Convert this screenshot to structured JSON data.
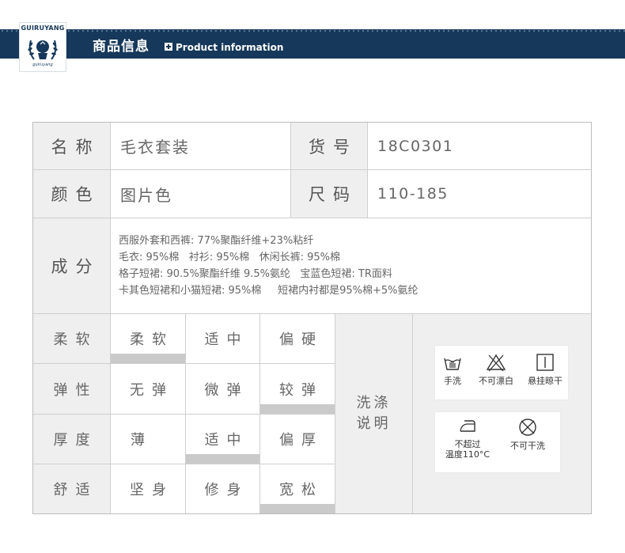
{
  "header": {
    "brand": "GUIRUYANG",
    "brand_sub": "guiruyang",
    "title_cn": "商品信息",
    "title_en": "Product information",
    "colors": {
      "banner": "#16385a",
      "gray_cell": "#efefef",
      "indicator": "#cacaca"
    }
  },
  "table": {
    "name_label": "名称",
    "name_value": "毛衣套装",
    "sku_label": "货号",
    "sku_value": "18C0301",
    "color_label": "颜色",
    "color_value": "图片色",
    "size_label": "尺码",
    "size_value": "110-185",
    "composition_label": "成分",
    "composition_lines": [
      "西服外套和西裤: 77%聚酯纤维+23%粘纤",
      "毛衣: 95%棉   衬衫: 95%棉   休闲长裤: 95%棉",
      "格子短裙: 90.5%聚酯纤维 9.5%氨纶   宝蓝色短裙: TR面料",
      "卡其色短裙和小猫短裙: 95%棉     短裙内衬都是95%棉+5%氨纶"
    ]
  },
  "attributes": [
    {
      "label": "柔软",
      "options": [
        "柔软",
        "适中",
        "偏硬"
      ],
      "selected": 0
    },
    {
      "label": "弹性",
      "options": [
        "无弹",
        "微弹",
        "较弹"
      ],
      "selected": 2
    },
    {
      "label": "厚度",
      "options": [
        "薄",
        "适中",
        "偏厚"
      ],
      "selected": 1
    },
    {
      "label": "舒适",
      "options": [
        "坚身",
        "修身",
        "宽松"
      ],
      "selected": 2
    }
  ],
  "care": {
    "label_line1": "洗涤",
    "label_line2": "说明",
    "items": [
      {
        "icon": "hand-wash-icon",
        "label": "手洗"
      },
      {
        "icon": "no-bleach-icon",
        "label": "不可漂白"
      },
      {
        "icon": "hang-dry-icon",
        "label": "悬挂晾干"
      },
      {
        "icon": "iron-icon",
        "label": "不超过\n温度110°C"
      },
      {
        "icon": "no-dry-clean-icon",
        "label": "不可干洗"
      }
    ]
  }
}
